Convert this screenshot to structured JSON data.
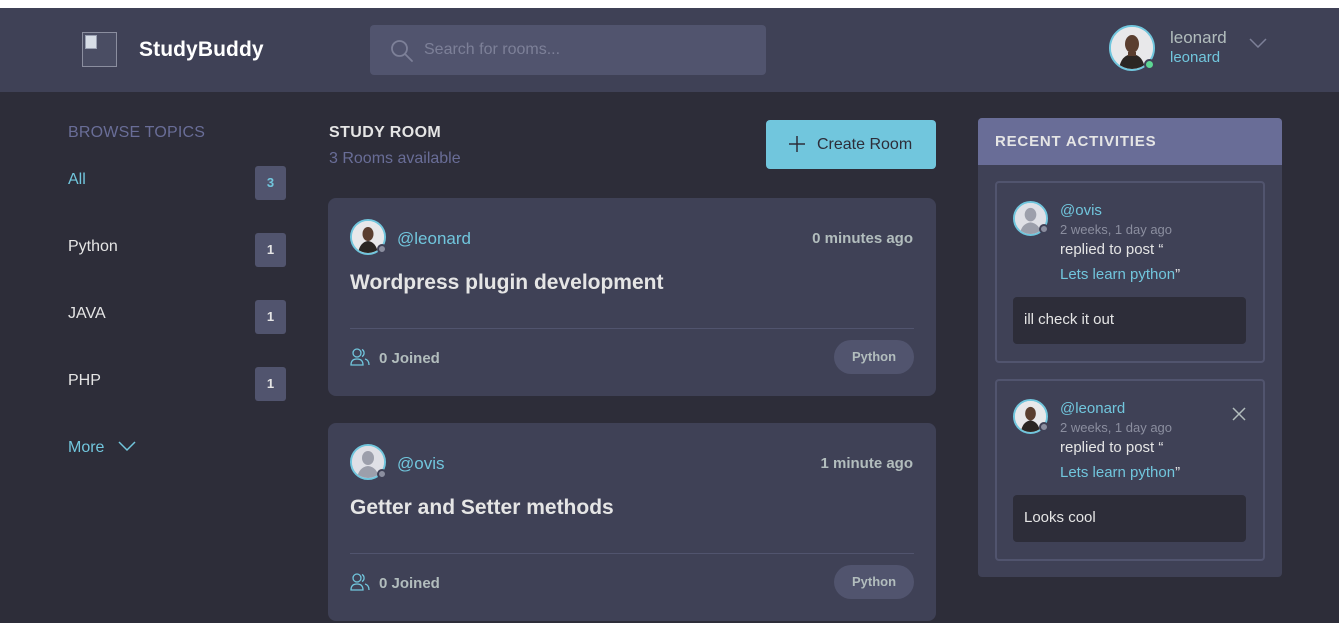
{
  "header": {
    "brand": "StudyBuddy",
    "search_placeholder": "Search for rooms...",
    "user_name": "leonard",
    "user_handle": "leonard"
  },
  "sidebar": {
    "heading": "BROWSE TOPICS",
    "topics": [
      {
        "label": "All",
        "count": "3"
      },
      {
        "label": "Python",
        "count": "1"
      },
      {
        "label": "JAVA",
        "count": "1"
      },
      {
        "label": "PHP",
        "count": "1"
      }
    ],
    "more_label": "More"
  },
  "feed": {
    "title": "STUDY ROOM",
    "subtitle": "3 Rooms available",
    "create_label": "Create Room",
    "rooms": [
      {
        "host": "@leonard",
        "time": "0 minutes ago",
        "title": "Wordpress plugin development",
        "joined": "0 Joined",
        "topic": "Python"
      },
      {
        "host": "@ovis",
        "time": "1 minute ago",
        "title": "Getter and Setter methods",
        "joined": "0 Joined",
        "topic": "Python"
      }
    ]
  },
  "activities": {
    "heading": "RECENT ACTIVITIES",
    "items": [
      {
        "user": "@ovis",
        "time": "2 weeks, 1 day ago",
        "action": "replied to post “",
        "post": "Lets learn python",
        "quote_close": "”",
        "message": "ill check it out"
      },
      {
        "user": "@leonard",
        "time": "2 weeks, 1 day ago",
        "action": "replied to post “",
        "post": "Lets learn python",
        "quote_close": "”",
        "message": "Looks cool"
      }
    ]
  },
  "colors": {
    "accent": "#71c6dd",
    "background": "#2d2d39",
    "panel": "#3f4156",
    "muted": "#696d97",
    "online": "#5dd693",
    "offline": "#8b8e9f"
  }
}
